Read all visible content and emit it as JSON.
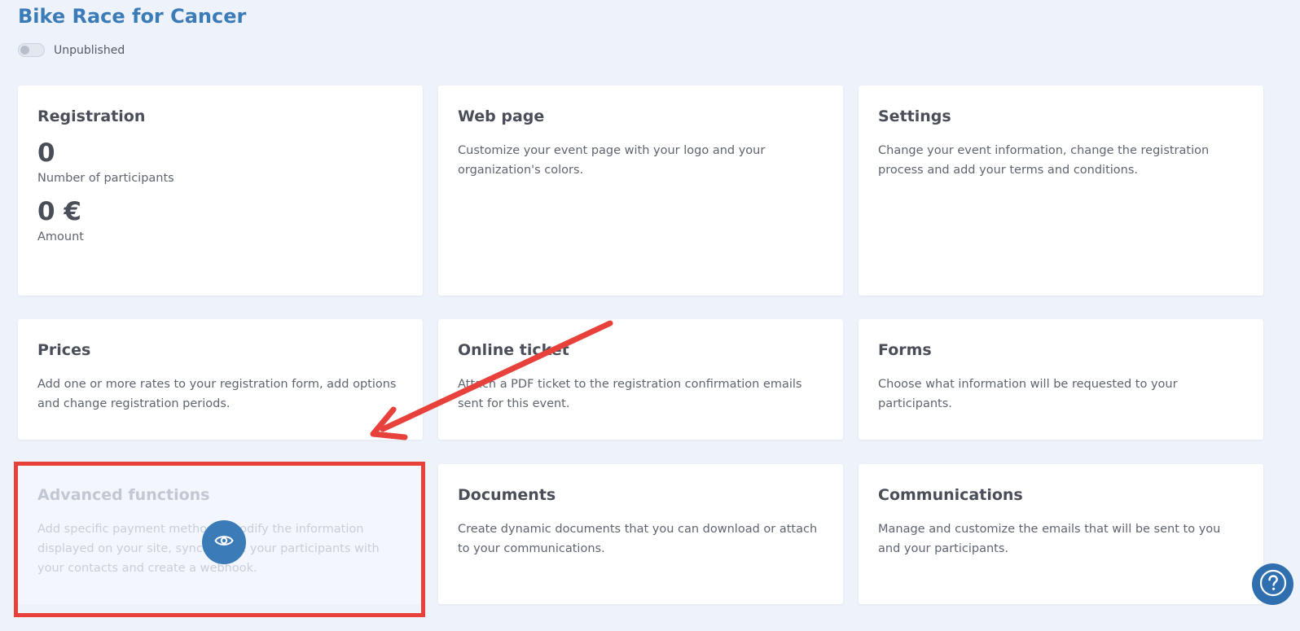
{
  "page": {
    "title": "Bike Race for Cancer",
    "background": "#eef2fa",
    "accent": "#3a7bb8"
  },
  "publish": {
    "label": "Unpublished",
    "checked": false
  },
  "cards": {
    "registration": {
      "title": "Registration",
      "participants_value": "0",
      "participants_label": "Number of participants",
      "amount_value": "0 €",
      "amount_label": "Amount"
    },
    "web_page": {
      "title": "Web page",
      "description": "Customize your event page with your logo and your organization's colors."
    },
    "settings": {
      "title": "Settings",
      "description": "Change your event information, change the registration process and add your terms and conditions."
    },
    "prices": {
      "title": "Prices",
      "description": "Add one or more rates to your registration form, add options and change registration periods."
    },
    "online_ticket": {
      "title": "Online ticket",
      "description": "Attach a PDF ticket to the registration confirmation emails sent for this event."
    },
    "forms": {
      "title": "Forms",
      "description": "Choose what information will be requested to your participants."
    },
    "advanced_functions": {
      "title": "Advanced functions",
      "description": "Add specific payment methods, modify the information displayed on your site, synchronize your participants with your contacts and create a webhook.",
      "state": "disabled"
    },
    "documents": {
      "title": "Documents",
      "description": "Create dynamic documents that you can download or attach to your communications."
    },
    "communications": {
      "title": "Communications",
      "description": "Manage and customize the emails that will be sent to you and your participants."
    }
  },
  "annotations": {
    "highlight_color": "#e8403a",
    "arrow_color": "#e8403a"
  },
  "icons": {
    "eye": "eye-icon",
    "help": "help-icon"
  }
}
